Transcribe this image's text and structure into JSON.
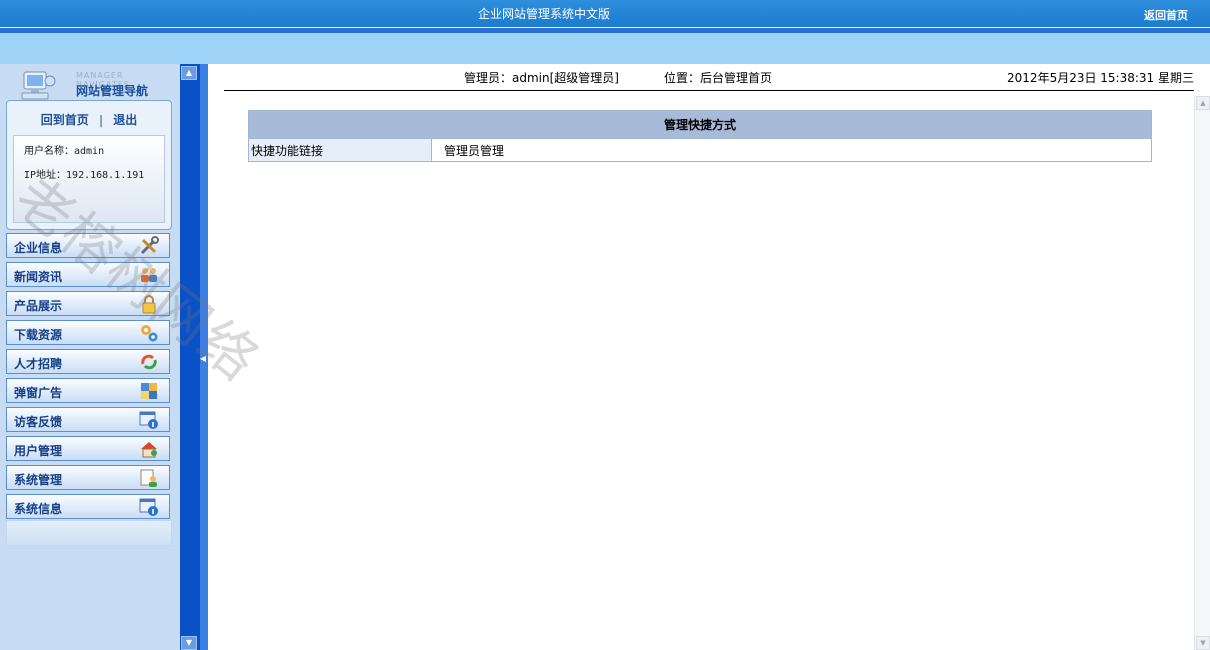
{
  "topbar": {
    "title": "企业网站管理系统中文版",
    "home_link": "返回首页"
  },
  "nav": {
    "en_title": "MANAGER NAVIGATES",
    "cn_title": "网站管理导航",
    "back_home": "回到首页",
    "separator": "|",
    "logout": "退出",
    "username_line": "用户名称：admin",
    "ip_line": "IP地址：192.168.1.191",
    "menu": [
      {
        "label": "企业信息",
        "icon": "tools-icon"
      },
      {
        "label": "新闻资讯",
        "icon": "users-icon"
      },
      {
        "label": "产品展示",
        "icon": "lock-icon"
      },
      {
        "label": "下载资源",
        "icon": "gears-icon"
      },
      {
        "label": "人才招聘",
        "icon": "recycle-icon"
      },
      {
        "label": "弹窗广告",
        "icon": "puzzle-icon"
      },
      {
        "label": "访客反馈",
        "icon": "info-window-icon"
      },
      {
        "label": "用户管理",
        "icon": "house-user-icon"
      },
      {
        "label": "系统管理",
        "icon": "user-document-icon"
      },
      {
        "label": "系统信息",
        "icon": "info-window-icon"
      }
    ]
  },
  "header": {
    "admin": "管理员：admin[超级管理员]",
    "position": "位置：后台管理首页",
    "datetime": "2012年5月23日 15:38:31 星期三"
  },
  "shortcut": {
    "title": "管理快捷方式",
    "row_label": "快捷功能链接",
    "row_value": "管理员管理"
  },
  "watermark": "老榕树网络",
  "colors": {
    "topbar": "#1b7bd0",
    "subbar": "#9fd3f7",
    "splitter": "#0a50c7",
    "menu_text": "#163f86"
  }
}
